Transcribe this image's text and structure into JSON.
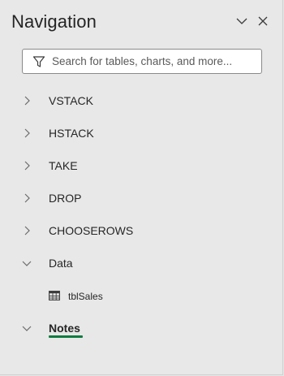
{
  "pane": {
    "title": "Navigation",
    "buttons": {
      "options_icon": "chevron-down-icon",
      "close_icon": "close-icon"
    }
  },
  "search": {
    "placeholder": "Search for tables, charts, and more...",
    "value": "",
    "icon": "filter-icon"
  },
  "tree": {
    "items": [
      {
        "label": "VSTACK",
        "expanded": false
      },
      {
        "label": "HSTACK",
        "expanded": false
      },
      {
        "label": "TAKE",
        "expanded": false
      },
      {
        "label": "DROP",
        "expanded": false
      },
      {
        "label": "CHOOSEROWS",
        "expanded": false
      },
      {
        "label": "Data",
        "expanded": true,
        "children": [
          {
            "label": "tblSales",
            "icon": "table-icon"
          }
        ]
      },
      {
        "label": "Notes",
        "expanded": true,
        "selected": true
      }
    ]
  },
  "colors": {
    "background": "#e8e8e8",
    "accent": "#107c41",
    "text": "#262626"
  }
}
